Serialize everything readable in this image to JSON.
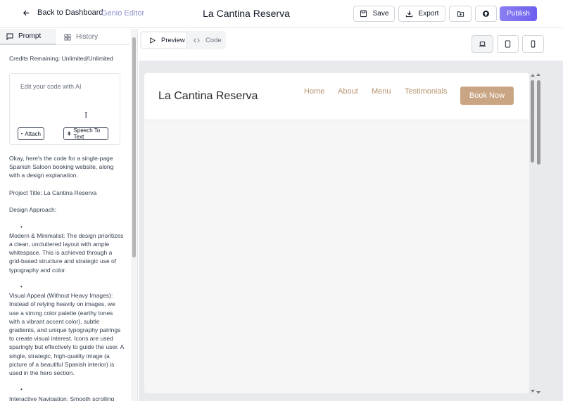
{
  "header": {
    "back_label": "Back to Dashboard",
    "brand": "Genio Editor",
    "title": "La Cantina Reserva",
    "save_label": "Save",
    "export_label": "Export",
    "publish_label": "Publish",
    "publish_gradient": [
      "#8b80f0",
      "#6d5ff0"
    ]
  },
  "left_panel": {
    "tabs": [
      {
        "label": "Prompt",
        "icon": "chat-icon"
      },
      {
        "label": "History",
        "icon": "grid-icon"
      }
    ],
    "credits": "Credits Remaining: Unlimited/Unlimited",
    "prompt_placeholder": "Edit your code with AI",
    "attach_label": "Attach",
    "speech_label": "Speech To Text",
    "response": {
      "intro": "Okay, here's the code for a single-page Spanish Saloon booking website, along with a design explanation.",
      "project_title": "Project Title: La Cantina Reserva",
      "approach_heading": "Design Approach:",
      "bullets": [
        "Modern & Minimalist: The design prioritizes a clean, uncluttered layout with ample whitespace. This is achieved through a grid-based structure and strategic use of typography and color.",
        "Visual Appeal (Without Heavy Images): Instead of relying heavily on images, we use a strong color palette (earthy tones with a vibrant accent color), subtle gradients, and unique typography pairings to create visual interest. Icons are used sparingly but effectively to guide the user. A single, strategic, high-quality image (a picture of a beautiful Spanish interior) is used in the hero section.",
        "Interactive Navigation: Smooth scrolling"
      ]
    }
  },
  "preview": {
    "tabs": [
      {
        "label": "Preview",
        "icon": "play-icon"
      },
      {
        "label": "Code",
        "icon": "code-icon"
      }
    ],
    "devices": [
      "laptop-icon",
      "tablet-icon",
      "mobile-icon"
    ]
  },
  "site": {
    "title": "La Cantina Reserva",
    "nav": [
      "Home",
      "About",
      "Menu",
      "Testimonials"
    ],
    "cta": "Book Now",
    "accent": "#c9a584",
    "link_color": "#b8926e"
  }
}
